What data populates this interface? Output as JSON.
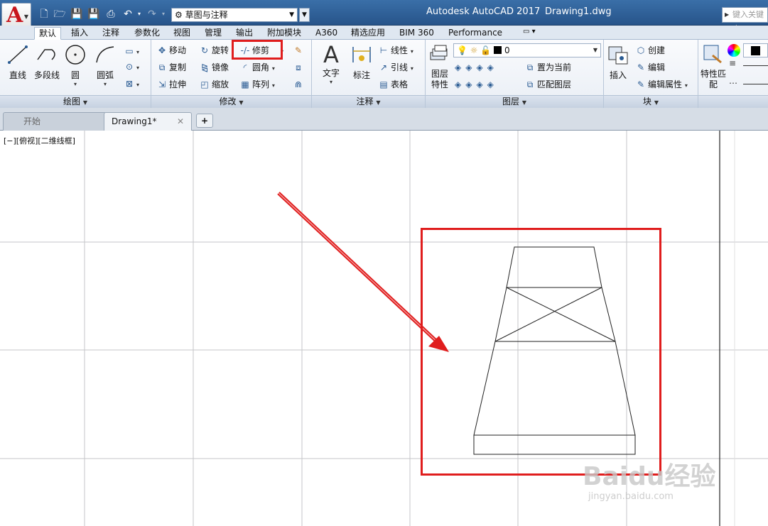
{
  "app": {
    "logo_letter": "A",
    "title": "Autodesk AutoCAD 2017",
    "document": "Drawing1.dwg",
    "workspace": "草图与注释",
    "search_placeholder": "键入关键字"
  },
  "ribbon_tabs": [
    "默认",
    "插入",
    "注释",
    "参数化",
    "视图",
    "管理",
    "输出",
    "附加模块",
    "A360",
    "精选应用",
    "BIM 360",
    "Performance"
  ],
  "panels": {
    "draw": {
      "title": "绘图",
      "line": "直线",
      "polyline": "多段线",
      "circle": "圆",
      "arc": "圆弧"
    },
    "modify": {
      "title": "修改",
      "move": "移动",
      "rotate": "旋转",
      "trim": "修剪",
      "copy": "复制",
      "mirror": "镜像",
      "fillet": "圆角",
      "stretch": "拉伸",
      "scale": "缩放",
      "array": "阵列"
    },
    "annotation": {
      "title": "注释",
      "text": "文字",
      "dimension": "标注",
      "linear": "线性",
      "leader": "引线",
      "table": "表格"
    },
    "layers": {
      "title": "图层",
      "properties": "图层特性",
      "current_layer": "0",
      "make_current": "置为当前",
      "match_layer": "匹配图层"
    },
    "block": {
      "title": "块",
      "insert": "插入",
      "create": "创建",
      "edit": "编辑",
      "edit_attributes": "编辑属性"
    },
    "properties": {
      "match": "特性匹配"
    }
  },
  "doc_tabs": {
    "start": "开始",
    "drawing": "Drawing1*",
    "add": "+"
  },
  "viewport_label": "[−][俯视][二维线框]",
  "watermark": {
    "brand": "Baidu经验",
    "url": "jingyan.baidu.com"
  },
  "colors": {
    "highlight": "#e01d1d",
    "titlebar": "#2f5f98",
    "brand_red": "#c8161d"
  }
}
